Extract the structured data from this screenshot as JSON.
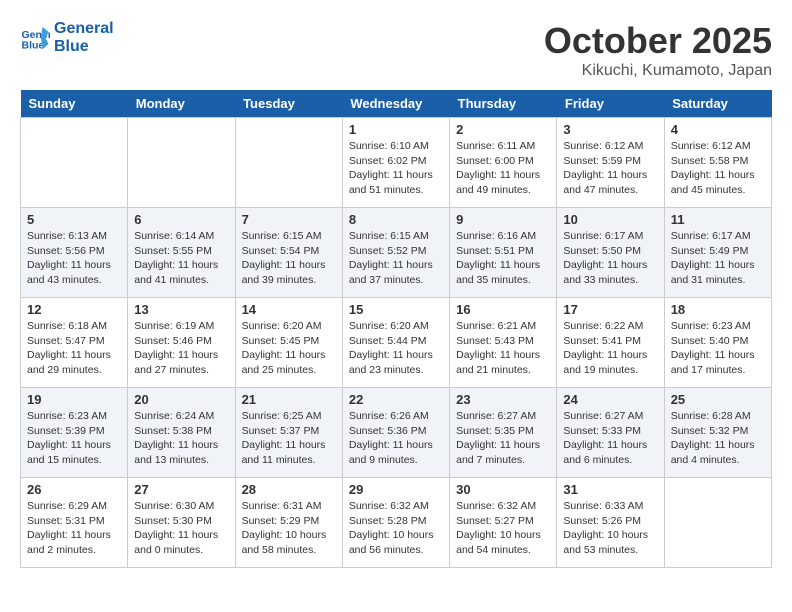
{
  "logo": {
    "line1": "General",
    "line2": "Blue"
  },
  "title": "October 2025",
  "subtitle": "Kikuchi, Kumamoto, Japan",
  "days_of_week": [
    "Sunday",
    "Monday",
    "Tuesday",
    "Wednesday",
    "Thursday",
    "Friday",
    "Saturday"
  ],
  "weeks": [
    [
      {
        "day": "",
        "info": ""
      },
      {
        "day": "",
        "info": ""
      },
      {
        "day": "",
        "info": ""
      },
      {
        "day": "1",
        "info": "Sunrise: 6:10 AM\nSunset: 6:02 PM\nDaylight: 11 hours\nand 51 minutes."
      },
      {
        "day": "2",
        "info": "Sunrise: 6:11 AM\nSunset: 6:00 PM\nDaylight: 11 hours\nand 49 minutes."
      },
      {
        "day": "3",
        "info": "Sunrise: 6:12 AM\nSunset: 5:59 PM\nDaylight: 11 hours\nand 47 minutes."
      },
      {
        "day": "4",
        "info": "Sunrise: 6:12 AM\nSunset: 5:58 PM\nDaylight: 11 hours\nand 45 minutes."
      }
    ],
    [
      {
        "day": "5",
        "info": "Sunrise: 6:13 AM\nSunset: 5:56 PM\nDaylight: 11 hours\nand 43 minutes."
      },
      {
        "day": "6",
        "info": "Sunrise: 6:14 AM\nSunset: 5:55 PM\nDaylight: 11 hours\nand 41 minutes."
      },
      {
        "day": "7",
        "info": "Sunrise: 6:15 AM\nSunset: 5:54 PM\nDaylight: 11 hours\nand 39 minutes."
      },
      {
        "day": "8",
        "info": "Sunrise: 6:15 AM\nSunset: 5:52 PM\nDaylight: 11 hours\nand 37 minutes."
      },
      {
        "day": "9",
        "info": "Sunrise: 6:16 AM\nSunset: 5:51 PM\nDaylight: 11 hours\nand 35 minutes."
      },
      {
        "day": "10",
        "info": "Sunrise: 6:17 AM\nSunset: 5:50 PM\nDaylight: 11 hours\nand 33 minutes."
      },
      {
        "day": "11",
        "info": "Sunrise: 6:17 AM\nSunset: 5:49 PM\nDaylight: 11 hours\nand 31 minutes."
      }
    ],
    [
      {
        "day": "12",
        "info": "Sunrise: 6:18 AM\nSunset: 5:47 PM\nDaylight: 11 hours\nand 29 minutes."
      },
      {
        "day": "13",
        "info": "Sunrise: 6:19 AM\nSunset: 5:46 PM\nDaylight: 11 hours\nand 27 minutes."
      },
      {
        "day": "14",
        "info": "Sunrise: 6:20 AM\nSunset: 5:45 PM\nDaylight: 11 hours\nand 25 minutes."
      },
      {
        "day": "15",
        "info": "Sunrise: 6:20 AM\nSunset: 5:44 PM\nDaylight: 11 hours\nand 23 minutes."
      },
      {
        "day": "16",
        "info": "Sunrise: 6:21 AM\nSunset: 5:43 PM\nDaylight: 11 hours\nand 21 minutes."
      },
      {
        "day": "17",
        "info": "Sunrise: 6:22 AM\nSunset: 5:41 PM\nDaylight: 11 hours\nand 19 minutes."
      },
      {
        "day": "18",
        "info": "Sunrise: 6:23 AM\nSunset: 5:40 PM\nDaylight: 11 hours\nand 17 minutes."
      }
    ],
    [
      {
        "day": "19",
        "info": "Sunrise: 6:23 AM\nSunset: 5:39 PM\nDaylight: 11 hours\nand 15 minutes."
      },
      {
        "day": "20",
        "info": "Sunrise: 6:24 AM\nSunset: 5:38 PM\nDaylight: 11 hours\nand 13 minutes."
      },
      {
        "day": "21",
        "info": "Sunrise: 6:25 AM\nSunset: 5:37 PM\nDaylight: 11 hours\nand 11 minutes."
      },
      {
        "day": "22",
        "info": "Sunrise: 6:26 AM\nSunset: 5:36 PM\nDaylight: 11 hours\nand 9 minutes."
      },
      {
        "day": "23",
        "info": "Sunrise: 6:27 AM\nSunset: 5:35 PM\nDaylight: 11 hours\nand 7 minutes."
      },
      {
        "day": "24",
        "info": "Sunrise: 6:27 AM\nSunset: 5:33 PM\nDaylight: 11 hours\nand 6 minutes."
      },
      {
        "day": "25",
        "info": "Sunrise: 6:28 AM\nSunset: 5:32 PM\nDaylight: 11 hours\nand 4 minutes."
      }
    ],
    [
      {
        "day": "26",
        "info": "Sunrise: 6:29 AM\nSunset: 5:31 PM\nDaylight: 11 hours\nand 2 minutes."
      },
      {
        "day": "27",
        "info": "Sunrise: 6:30 AM\nSunset: 5:30 PM\nDaylight: 11 hours\nand 0 minutes."
      },
      {
        "day": "28",
        "info": "Sunrise: 6:31 AM\nSunset: 5:29 PM\nDaylight: 10 hours\nand 58 minutes."
      },
      {
        "day": "29",
        "info": "Sunrise: 6:32 AM\nSunset: 5:28 PM\nDaylight: 10 hours\nand 56 minutes."
      },
      {
        "day": "30",
        "info": "Sunrise: 6:32 AM\nSunset: 5:27 PM\nDaylight: 10 hours\nand 54 minutes."
      },
      {
        "day": "31",
        "info": "Sunrise: 6:33 AM\nSunset: 5:26 PM\nDaylight: 10 hours\nand 53 minutes."
      },
      {
        "day": "",
        "info": ""
      }
    ]
  ]
}
